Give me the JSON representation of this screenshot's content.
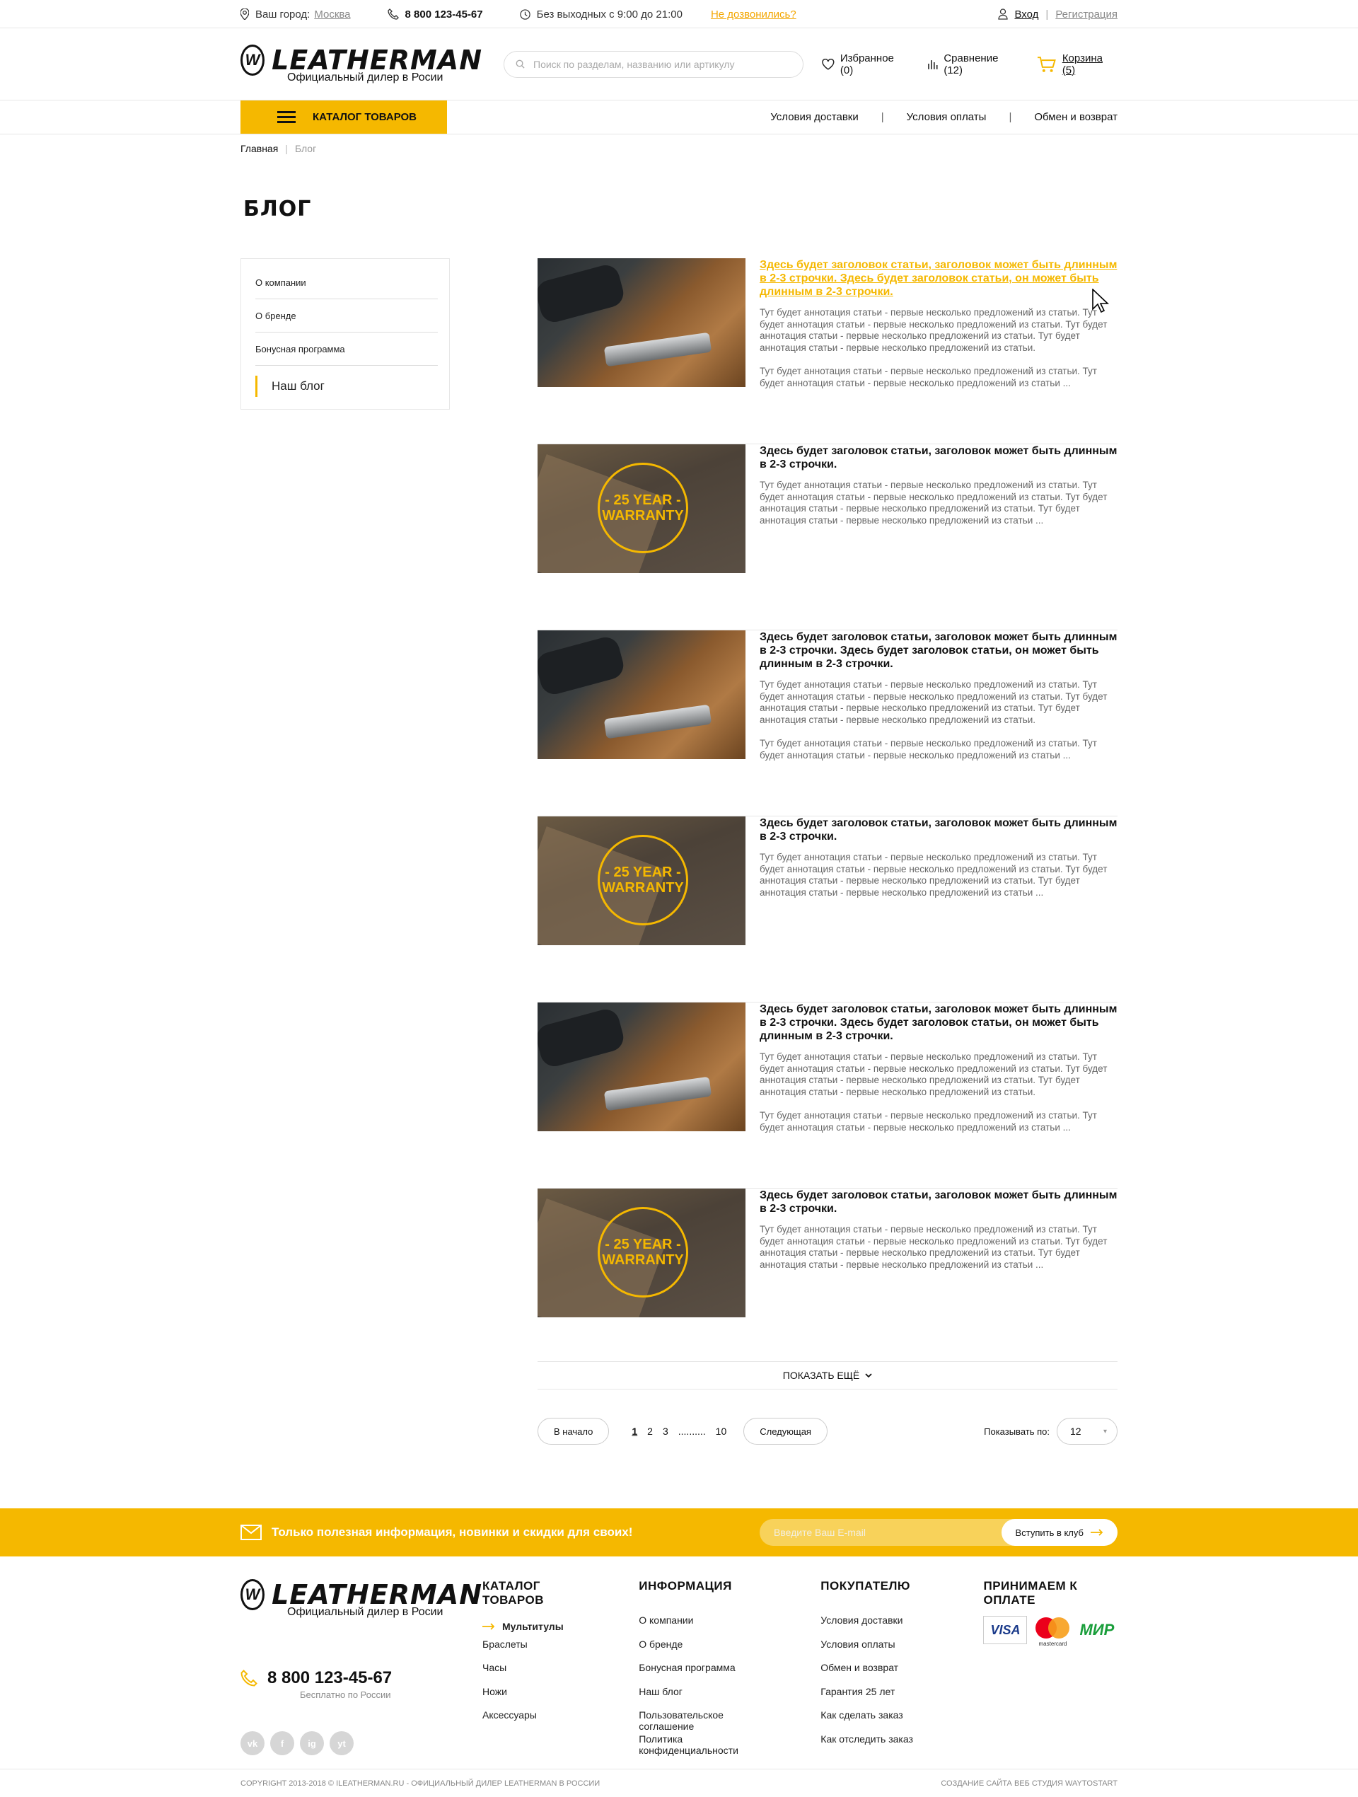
{
  "topbar": {
    "city_label": "Ваш город:",
    "city": "Москва",
    "phone": "8 800 123-45-67",
    "hours": "Без выходных с 9:00 до 21:00",
    "callback": "Не дозвонились?",
    "login": "Вход",
    "register": "Регистрация"
  },
  "header": {
    "logo_word": "LEATHERMAN",
    "logo_sub": "Официальный дилер в Росии",
    "search_placeholder": "Поиск по разделам, названию или артикулу",
    "favorites": "Избранное (0)",
    "compare": "Сравнение (12)",
    "cart": "Корзина (5)"
  },
  "nav": {
    "catalog": "КАТАЛОГ ТОВАРОВ",
    "links": [
      "Условия доставки",
      "Условия оплаты",
      "Обмен и возврат"
    ]
  },
  "breadcrumb": {
    "home": "Главная",
    "current": "Блог"
  },
  "page_title": "БЛОГ",
  "sidebar": [
    "О компании",
    "О бренде",
    "Бонусная программа",
    "Наш блог"
  ],
  "articles": [
    {
      "title": "Здесь будет заголовок статьи, заголовок может быть длинным в 2-3 строчки. Здесь будет заголовок статьи, он может быть длинным в 2-3 строчки.",
      "p1": "Тут будет аннотация статьи - первые несколько предложений из статьи. Тут будет аннотация статьи - первые несколько предложений из статьи. Тут будет аннотация статьи - первые несколько предложений из статьи. Тут будет аннотация статьи - первые несколько предложений из статьи.",
      "p2": "Тут будет аннотация статьи - первые несколько предложений из статьи. Тут будет аннотация статьи - первые несколько предложений из статьи ..."
    },
    {
      "title": "Здесь будет заголовок статьи, заголовок может быть длинным в 2-3 строчки.",
      "p1": "Тут будет аннотация статьи - первые несколько предложений из статьи. Тут будет аннотация статьи - первые несколько предложений из статьи. Тут будет аннотация статьи - первые несколько предложений из статьи. Тут будет аннотация статьи - первые несколько предложений из статьи ...",
      "p2": ""
    },
    {
      "title": "Здесь будет заголовок статьи, заголовок может быть длинным в 2-3 строчки. Здесь будет заголовок статьи, он может быть длинным в 2-3 строчки.",
      "p1": "Тут будет аннотация статьи - первые несколько предложений из статьи. Тут будет аннотация статьи - первые несколько предложений из статьи. Тут будет аннотация статьи - первые несколько предложений из статьи. Тут будет аннотация статьи - первые несколько предложений из статьи.",
      "p2": "Тут будет аннотация статьи - первые несколько предложений из статьи. Тут будет аннотация статьи - первые несколько предложений из статьи ..."
    },
    {
      "title": "Здесь будет заголовок статьи, заголовок может быть длинным в 2-3 строчки.",
      "p1": "Тут будет аннотация статьи - первые несколько предложений из статьи. Тут будет аннотация статьи - первые несколько предложений из статьи. Тут будет аннотация статьи - первые несколько предложений из статьи. Тут будет аннотация статьи - первые несколько предложений из статьи ...",
      "p2": ""
    },
    {
      "title": "Здесь будет заголовок статьи, заголовок может быть длинным в 2-3 строчки. Здесь будет заголовок статьи, он может быть длинным в 2-3 строчки.",
      "p1": "Тут будет аннотация статьи - первые несколько предложений из статьи. Тут будет аннотация статьи - первые несколько предложений из статьи. Тут будет аннотация статьи - первые несколько предложений из статьи. Тут будет аннотация статьи - первые несколько предложений из статьи.",
      "p2": "Тут будет аннотация статьи - первые несколько предложений из статьи. Тут будет аннотация статьи - первые несколько предложений из статьи ..."
    },
    {
      "title": "Здесь будет заголовок статьи, заголовок может быть длинным в 2-3 строчки.",
      "p1": "Тут будет аннотация статьи - первые несколько предложений из статьи. Тут будет аннотация статьи - первые несколько предложений из статьи. Тут будет аннотация статьи - первые несколько предложений из статьи. Тут будет аннотация статьи - первые несколько предложений из статьи ...",
      "p2": ""
    }
  ],
  "warranty": {
    "line1": "- 25 YEAR -",
    "line2": "WARRANTY"
  },
  "show_more": "ПОКАЗАТЬ ЕЩЁ",
  "pager": {
    "first": "В начало",
    "pages": [
      "1",
      "2",
      "3",
      "..........",
      "10"
    ],
    "next": "Следующая",
    "per_label": "Показывать по:",
    "per_value": "12"
  },
  "subscribe": {
    "text": "Только полезная информация, новинки и скидки для своих!",
    "placeholder": "Введите Ваш E-mail",
    "button": "Вступить в клуб"
  },
  "footer": {
    "phone": "8 800 123-45-67",
    "phone_sub": "Бесплатно по России",
    "socials": [
      "vk",
      "f",
      "ig",
      "yt"
    ],
    "catalog_head": "КАТАЛОГ ТОВАРОВ",
    "catalog": [
      "Мультитулы",
      "Браслеты",
      "Часы",
      "Ножи",
      "Аксессуары"
    ],
    "info_head": "ИНФОРМАЦИЯ",
    "info": [
      "О компании",
      "О бренде",
      "Бонусная программа",
      "Наш блог",
      "Пользовательское соглашение",
      "Политика конфиденциальности"
    ],
    "buyer_head": "ПОКУПАТЕЛЮ",
    "buyer": [
      "Условия доставки",
      "Условия оплаты",
      "Обмен и возврат",
      "Гарантия 25 лет",
      "Как сделать заказ",
      "Как отследить заказ"
    ],
    "pay_head": "ПРИНИМАЕМ К ОПЛАТЕ",
    "visa": "VISA",
    "mastercard": "mastercard",
    "mir": "МИР",
    "copyright": "COPYRIGHT 2013-2018 © ILEATHERMAN.RU - ОФИЦИАЛЬНЫЙ ДИЛЕР LEATHERMAN В РОССИИ",
    "studio": "СОЗДАНИЕ САЙТА ВЕБ СТУДИЯ WAYTOSTART"
  },
  "colors": {
    "accent": "#f5b800"
  }
}
